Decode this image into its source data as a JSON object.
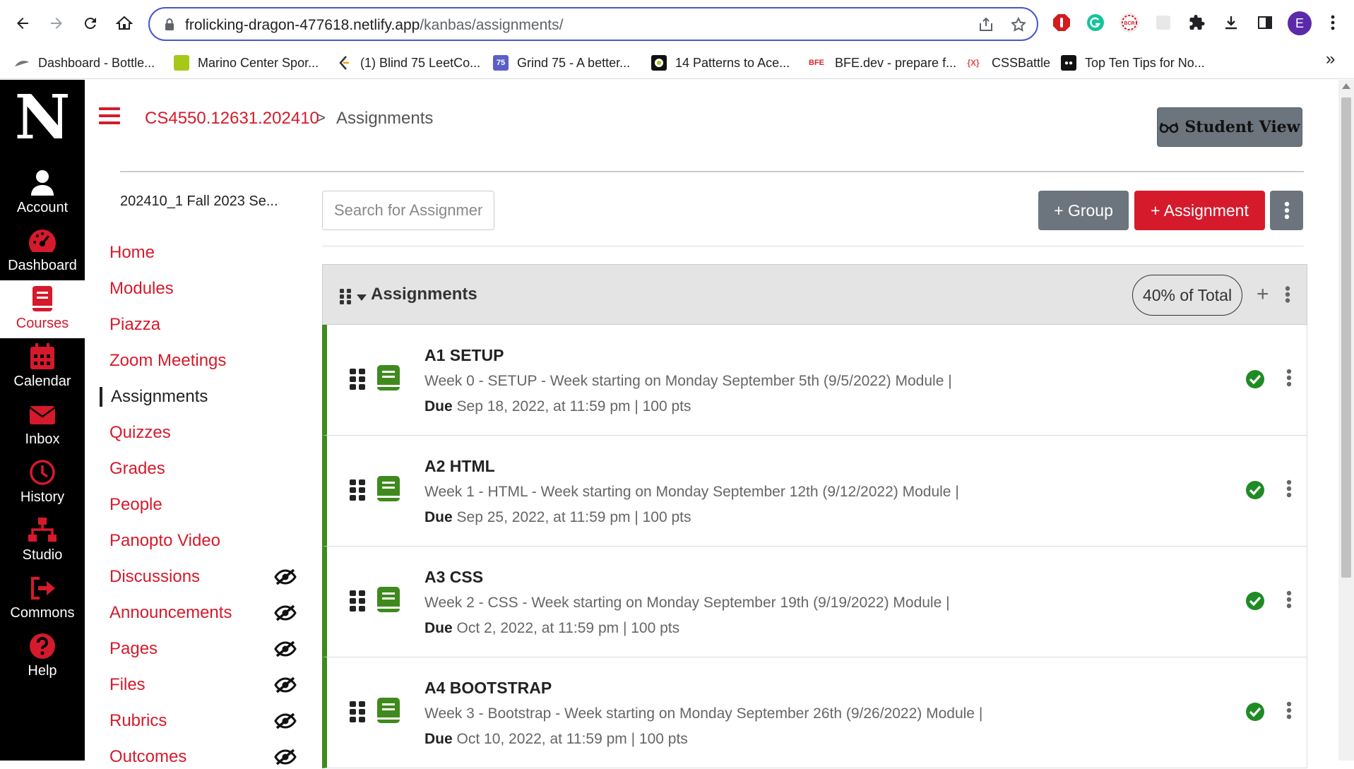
{
  "browser": {
    "url_host": "frolicking-dragon-477618.netlify.app",
    "url_path": "/kanbas/assignments/",
    "avatar_letter": "E",
    "bookmarks": [
      {
        "label": "Dashboard - Bottle...",
        "icon": "bottle-icon"
      },
      {
        "label": "Marino Center Spor...",
        "icon": "marino-icon"
      },
      {
        "label": "(1) Blind 75 LeetCo...",
        "icon": "leetcode-icon"
      },
      {
        "label": "Grind 75 - A better...",
        "icon": "grind75-icon",
        "badge": "75"
      },
      {
        "label": "14 Patterns to Ace...",
        "icon": "patterns-icon"
      },
      {
        "label": "BFE.dev - prepare f...",
        "icon": "bfe-icon",
        "badge": "BFE"
      },
      {
        "label": "CSSBattle",
        "icon": "cssbattle-icon",
        "badge": "{X}"
      },
      {
        "label": "Top Ten Tips for No...",
        "icon": "medium-icon"
      }
    ],
    "bookmarks_more": "»"
  },
  "global_nav": {
    "logo": "N",
    "items": [
      {
        "label": "Account",
        "icon": "account-icon"
      },
      {
        "label": "Dashboard",
        "icon": "dashboard-icon"
      },
      {
        "label": "Courses",
        "icon": "courses-icon"
      },
      {
        "label": "Calendar",
        "icon": "calendar-icon"
      },
      {
        "label": "Inbox",
        "icon": "inbox-icon"
      },
      {
        "label": "History",
        "icon": "history-icon"
      },
      {
        "label": "Studio",
        "icon": "studio-icon"
      },
      {
        "label": "Commons",
        "icon": "commons-icon"
      },
      {
        "label": "Help",
        "icon": "help-icon"
      }
    ],
    "active": "Courses"
  },
  "breadcrumb": {
    "course": "CS4550.12631.202410",
    "separator": ">",
    "page": "Assignments"
  },
  "student_view_label": "Student View",
  "course_nav": {
    "term": "202410_1 Fall 2023 Se...",
    "items": [
      {
        "label": "Home",
        "hidden": false
      },
      {
        "label": "Modules",
        "hidden": false
      },
      {
        "label": "Piazza",
        "hidden": false
      },
      {
        "label": "Zoom Meetings",
        "hidden": false
      },
      {
        "label": "Assignments",
        "hidden": false
      },
      {
        "label": "Quizzes",
        "hidden": false
      },
      {
        "label": "Grades",
        "hidden": false
      },
      {
        "label": "People",
        "hidden": false
      },
      {
        "label": "Panopto Video",
        "hidden": false
      },
      {
        "label": "Discussions",
        "hidden": true
      },
      {
        "label": "Announcements",
        "hidden": true
      },
      {
        "label": "Pages",
        "hidden": true
      },
      {
        "label": "Files",
        "hidden": true
      },
      {
        "label": "Rubrics",
        "hidden": true
      },
      {
        "label": "Outcomes",
        "hidden": true
      }
    ],
    "active": "Assignments"
  },
  "toolbar": {
    "search_placeholder": "Search for Assignments",
    "group_label": "+ Group",
    "assignment_label": "+ Assignment"
  },
  "assignment_group": {
    "title": "Assignments",
    "weight": "40% of Total",
    "add": "+"
  },
  "assignments": [
    {
      "title": "A1 SETUP",
      "subtitle": "Week 0 - SETUP - Week starting on Monday September 5th (9/5/2022) Module |",
      "due_label": "Due",
      "due": "Sep 18, 2022, at 11:59 pm | 100 pts"
    },
    {
      "title": "A2 HTML",
      "subtitle": "Week 1 - HTML - Week starting on Monday September 12th (9/12/2022) Module |",
      "due_label": "Due",
      "due": "Sep 25, 2022, at 11:59 pm | 100 pts"
    },
    {
      "title": "A3 CSS",
      "subtitle": "Week 2 - CSS - Week starting on Monday September 19th (9/19/2022) Module |",
      "due_label": "Due",
      "due": "Oct 2, 2022, at 11:59 pm | 100 pts"
    },
    {
      "title": "A4 BOOTSTRAP",
      "subtitle": "Week 3 - Bootstrap - Week starting on Monday September 26th (9/26/2022) Module |",
      "due_label": "Due",
      "due": "Oct 10, 2022, at 11:59 pm | 100 pts"
    }
  ],
  "colors": {
    "brand_red": "#d51a2b",
    "published_green": "#3f8a1d",
    "secondary_gray": "#6c757d"
  }
}
